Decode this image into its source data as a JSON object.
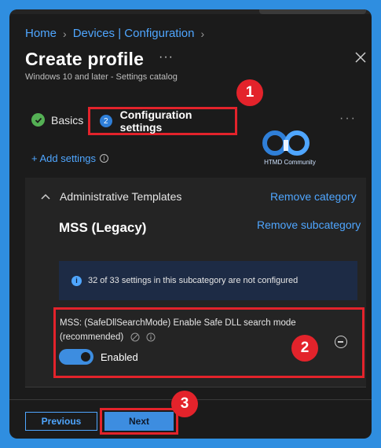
{
  "breadcrumb": {
    "items": [
      "Home",
      "Devices | Configuration"
    ]
  },
  "header": {
    "title": "Create profile",
    "more_label": "···",
    "subtitle": "Windows 10 and later - Settings catalog"
  },
  "steps": {
    "basics_label": "Basics",
    "config_number": "2",
    "config_label": "Configuration settings"
  },
  "annotations": {
    "badge_1": "1",
    "badge_2": "2",
    "badge_3": "3"
  },
  "logo": {
    "caption": "HTMD Community"
  },
  "add_settings": {
    "label": "+ Add settings",
    "info_icon": "i"
  },
  "category": {
    "name": "Administrative Templates",
    "remove_label": "Remove category",
    "subcategory": "MSS (Legacy)",
    "remove_sub_label": "Remove subcategory"
  },
  "info_bar": {
    "icon": "i",
    "text": "32 of 33 settings in this subcategory are not configured"
  },
  "setting": {
    "name": "MSS: (SafeDllSearchMode) Enable Safe DLL search mode (recommended)",
    "toggle_state": "Enabled",
    "enabled": true
  },
  "footer": {
    "previous_label": "Previous",
    "next_label": "Next"
  },
  "colors": {
    "accent": "#4fa6ff",
    "highlight": "#e3232b",
    "background": "#1b1b1b",
    "success": "#54b054"
  }
}
